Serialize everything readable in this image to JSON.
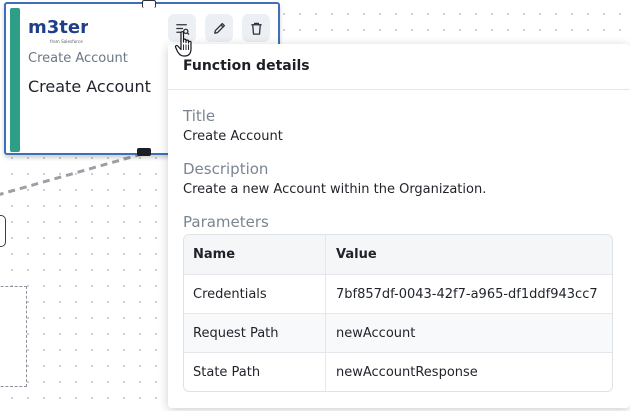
{
  "node": {
    "logo_text": "m3ter",
    "logo_tagline": "from Salesforce",
    "subtitle": "Create Account",
    "title": "Create Account"
  },
  "toolbar": {
    "details_icon": "list-search-icon",
    "edit_icon": "pencil-icon",
    "delete_icon": "trash-icon"
  },
  "popover": {
    "heading": "Function details",
    "title_label": "Title",
    "title_value": "Create Account",
    "description_label": "Description",
    "description_value": "Create a new Account within the Organization.",
    "parameters_label": "Parameters",
    "table": {
      "headers": [
        "Name",
        "Value"
      ],
      "rows": [
        [
          "Credentials",
          "7bf857df-0043-42f7-a965-df1ddf943cc7"
        ],
        [
          "Request Path",
          "newAccount"
        ],
        [
          "State Path",
          "newAccountResponse"
        ]
      ]
    }
  },
  "colors": {
    "node_border": "#3f6fb6",
    "node_accent": "#2e9e86",
    "logo_primary": "#1f3f8a",
    "logo_accent": "#2e9e86"
  }
}
